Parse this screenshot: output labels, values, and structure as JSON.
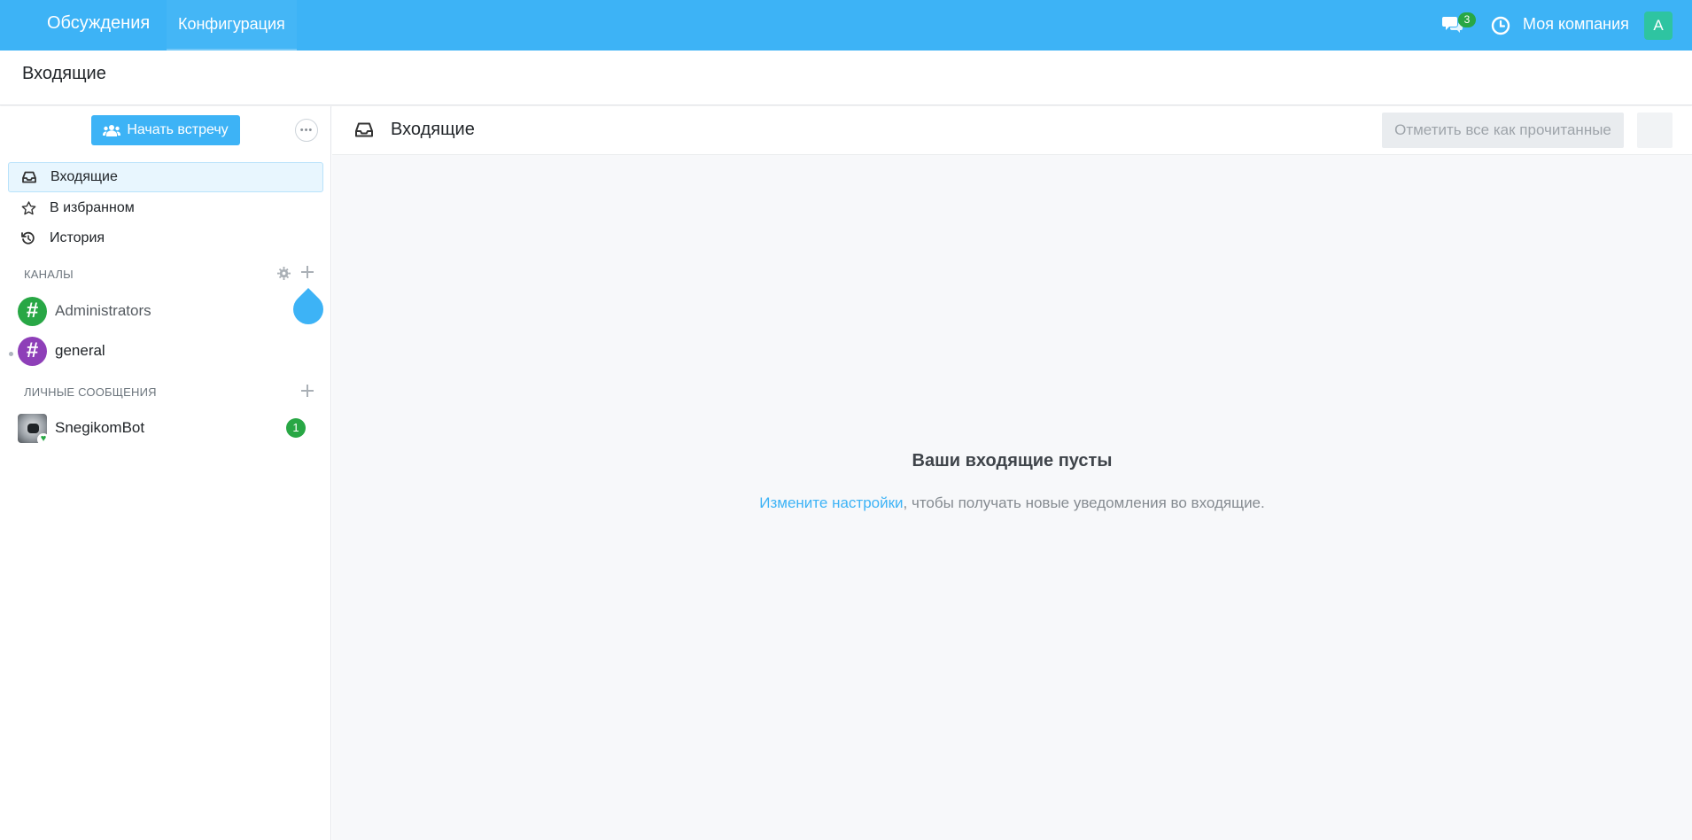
{
  "navbar": {
    "app_name": "Обсуждения",
    "menu_item": "Конфигурация",
    "chat_unread_count": "3",
    "company": "Моя компания",
    "user_avatar_letter": "A"
  },
  "breadcrumb": "Входящие",
  "sidebar": {
    "start_meeting_label": "Начать встречу",
    "mailboxes": [
      {
        "label": "Входящие",
        "icon": "inbox-icon",
        "active": true
      },
      {
        "label": "В избранном",
        "icon": "star-icon",
        "active": false
      },
      {
        "label": "История",
        "icon": "history-icon",
        "active": false
      }
    ],
    "channels_title": "КАНАЛЫ",
    "channels": [
      {
        "name": "Administrators",
        "color": "#28a745"
      },
      {
        "name": "general",
        "color": "#8e3fb8"
      }
    ],
    "direct_title": "ЛИЧНЫЕ СООБЩЕНИЯ",
    "direct": [
      {
        "name": "SnegikomBot",
        "unread": "1"
      }
    ]
  },
  "main": {
    "title": "Входящие",
    "mark_all_read": "Отметить все как прочитанные",
    "empty_title": "Ваши входящие пусты",
    "empty_link": "Измените настройки",
    "empty_text": ", чтобы получать новые уведомления во входящие."
  },
  "colors": {
    "brand": "#3db3f6",
    "success": "#28a745"
  }
}
